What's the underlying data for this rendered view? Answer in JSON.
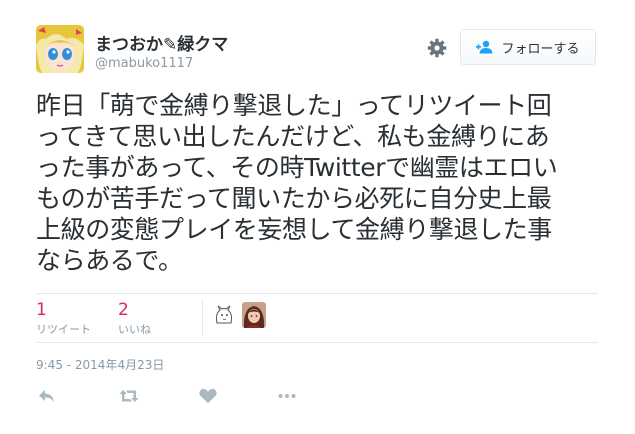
{
  "user": {
    "display_name": "まつおか✎緑クマ",
    "screen_name": "@mabuko1117"
  },
  "follow_button": {
    "label": "フォローする"
  },
  "tweet": {
    "lines": [
      "昨日「萌で金縛り撃退した」ってリツイート回",
      "ってきて思い出したんだけど、私も金縛りにあ",
      "った事があって、その時Twitterで幽霊はエロい",
      "ものが苦手だって聞いたから必死に自分史上最",
      "上級の変態プレイを妄想して金縛り撃退した事",
      "ならあるで。"
    ]
  },
  "stats": {
    "retweets": {
      "count": "1",
      "label": "リツイート"
    },
    "likes": {
      "count": "2",
      "label": "いいね"
    }
  },
  "timestamp": "9:45 - 2014年4月23日",
  "icons": {
    "settings": "gear-icon",
    "follow": "person-add-icon",
    "reply": "reply-icon",
    "retweet": "retweet-icon",
    "like": "heart-icon",
    "more": "more-icon"
  },
  "colors": {
    "like_count": "#e0245e",
    "muted": "#8899a6",
    "text": "#292f33",
    "divider": "#e1e8ed"
  }
}
